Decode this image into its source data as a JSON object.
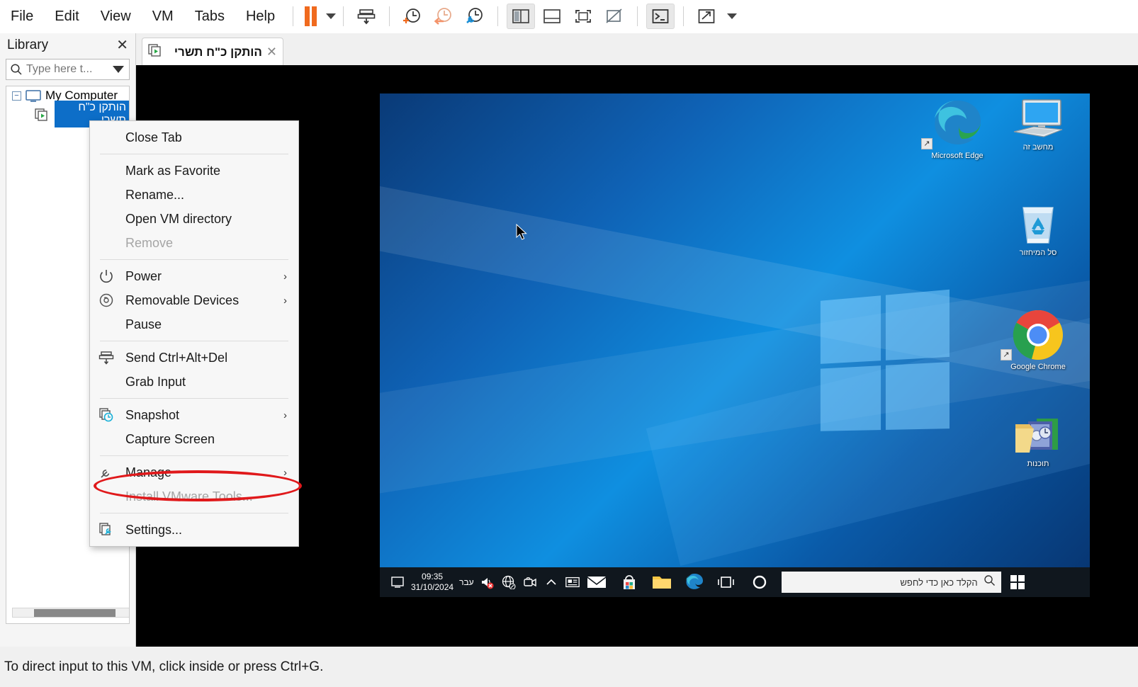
{
  "menubar": {
    "items": [
      {
        "label": "File",
        "name": "menu-file"
      },
      {
        "label": "Edit",
        "name": "menu-edit"
      },
      {
        "label": "View",
        "name": "menu-view"
      },
      {
        "label": "VM",
        "name": "menu-vm"
      },
      {
        "label": "Tabs",
        "name": "menu-tabs"
      },
      {
        "label": "Help",
        "name": "menu-help"
      }
    ],
    "toolbar_icons": [
      "pause-icon",
      "chevron-down-icon",
      "send-ctrl-alt-del-icon",
      "take-snapshot-icon",
      "revert-snapshot-icon",
      "snapshot-manager-icon",
      "show-library-icon",
      "show-thumbnail-bar-icon",
      "full-screen-icon",
      "unity-mode-icon",
      "console-icon",
      "stretch-icon",
      "chevron-down-icon"
    ]
  },
  "library": {
    "title": "Library",
    "close_label": "✕",
    "search_placeholder": "Type here t...",
    "search_value": "",
    "tree": {
      "root_label": "My Computer",
      "root_toggle": "−",
      "child_label": "הותקן כ\"ח תשרי"
    }
  },
  "tab": {
    "title": "הותקן כ\"ח תשרי",
    "close_label": "✕"
  },
  "context_menu": {
    "items": [
      {
        "label": "Close Tab",
        "icon": "",
        "submenu": false,
        "disabled": false,
        "sep_after": true
      },
      {
        "label": "Mark as Favorite",
        "icon": "",
        "submenu": false,
        "disabled": false,
        "sep_after": false
      },
      {
        "label": "Rename...",
        "icon": "",
        "submenu": false,
        "disabled": false,
        "sep_after": false
      },
      {
        "label": "Open VM directory",
        "icon": "",
        "submenu": false,
        "disabled": false,
        "sep_after": false
      },
      {
        "label": "Remove",
        "icon": "",
        "submenu": false,
        "disabled": true,
        "sep_after": true
      },
      {
        "label": "Power",
        "icon": "power-icon",
        "submenu": true,
        "disabled": false,
        "sep_after": false
      },
      {
        "label": "Removable Devices",
        "icon": "disc-icon",
        "submenu": true,
        "disabled": false,
        "sep_after": false
      },
      {
        "label": "Pause",
        "icon": "",
        "submenu": false,
        "disabled": false,
        "sep_after": true
      },
      {
        "label": "Send Ctrl+Alt+Del",
        "icon": "send-ctrl-alt-del-icon",
        "submenu": false,
        "disabled": false,
        "sep_after": false
      },
      {
        "label": "Grab Input",
        "icon": "",
        "submenu": false,
        "disabled": false,
        "sep_after": true
      },
      {
        "label": "Snapshot",
        "icon": "snapshot-icon",
        "submenu": true,
        "disabled": false,
        "sep_after": false
      },
      {
        "label": "Capture Screen",
        "icon": "",
        "submenu": false,
        "disabled": false,
        "sep_after": true
      },
      {
        "label": "Manage",
        "icon": "wrench-icon",
        "submenu": true,
        "disabled": false,
        "sep_after": false
      },
      {
        "label": "Install VMware Tools...",
        "icon": "",
        "submenu": false,
        "disabled": true,
        "sep_after": true
      },
      {
        "label": "Settings...",
        "icon": "settings-icon",
        "submenu": false,
        "disabled": false,
        "sep_after": false
      }
    ],
    "submenu_arrow": "›",
    "annotation": {
      "shape": "ellipse",
      "color": "#e0191b",
      "targets": "Install VMware Tools..."
    }
  },
  "guest_desktop": {
    "icons": [
      {
        "label": "Microsoft Edge",
        "name": "desktop-icon-edge",
        "rtl": false
      },
      {
        "label": "מחשב זה",
        "name": "desktop-icon-this-pc",
        "rtl": true
      },
      {
        "label": "סל המיחזור",
        "name": "desktop-icon-recycle-bin",
        "rtl": true
      },
      {
        "label": "Google Chrome",
        "name": "desktop-icon-chrome",
        "rtl": false
      },
      {
        "label": "תוכנות",
        "name": "desktop-icon-software-folder",
        "rtl": true
      }
    ],
    "taskbar": {
      "search_placeholder": "הקלד כאן כדי לחפש",
      "clock_time": "09:35",
      "clock_date": "31/10/2024",
      "language": "עבר",
      "tray_icons": [
        "volume-muted-icon",
        "network-disconnected-icon",
        "camera-icon",
        "show-hidden-icons-icon",
        "action-center-icon"
      ],
      "pinned_icons": [
        "mail-icon",
        "microsoft-store-icon",
        "file-explorer-icon",
        "edge-icon",
        "task-view-icon",
        "cortana-icon"
      ],
      "start_icon": "windows-start-icon",
      "search_icon": "search-icon"
    }
  },
  "statusbar": {
    "message": "To direct input to this VM, click inside or press Ctrl+G."
  },
  "colors": {
    "accent_orange": "#f06a1e",
    "selection_blue": "#0d6ec8",
    "annotation_red": "#e0191b",
    "desktop_blue": "#0f62b5"
  }
}
